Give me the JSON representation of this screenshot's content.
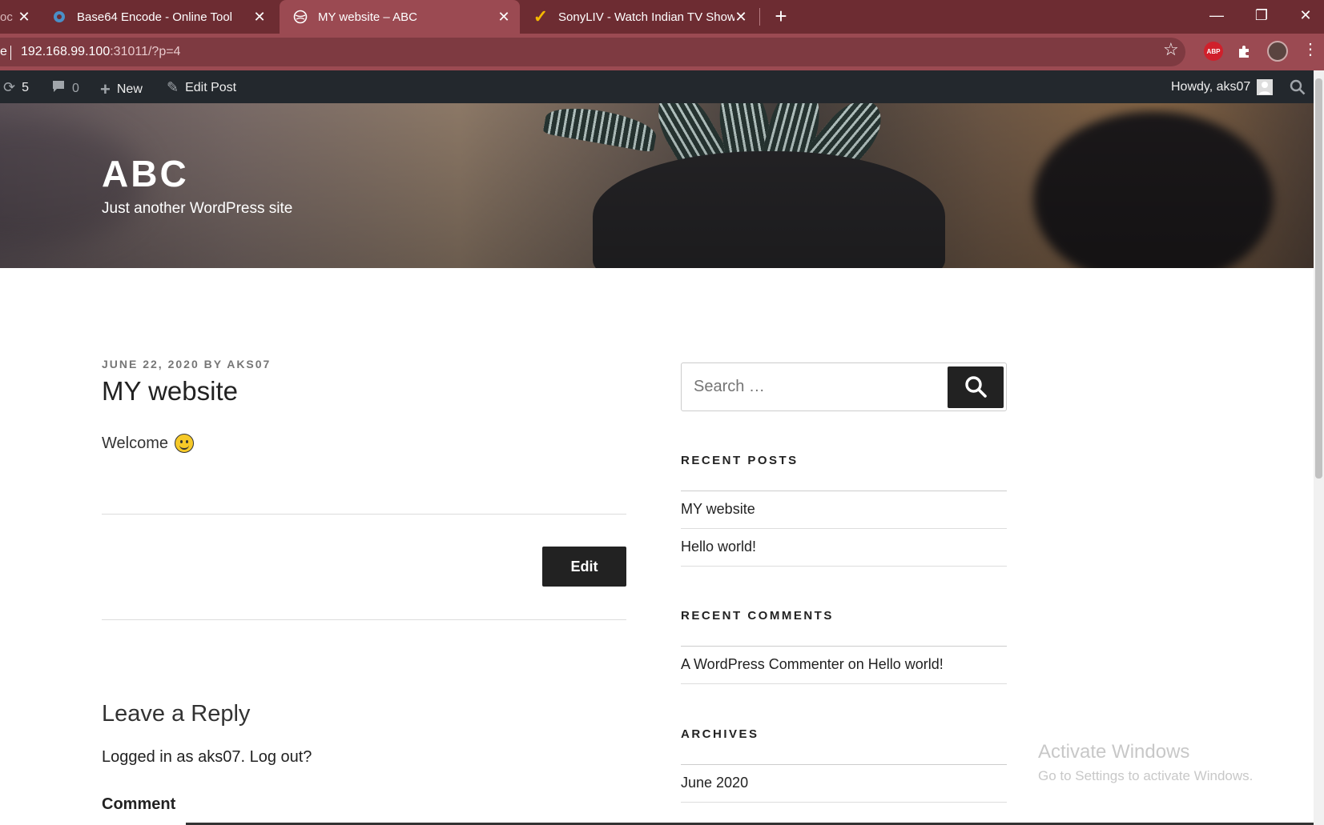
{
  "browser": {
    "tabs": [
      {
        "title": "oc",
        "icon": "doc-icon"
      },
      {
        "title": "Base64 Encode - Online Tool",
        "icon": "gear-icon"
      },
      {
        "title": "MY website – ABC",
        "icon": "globe-icon",
        "active": true
      },
      {
        "title": "SonyLIV - Watch Indian TV Show",
        "icon": "check-icon"
      }
    ],
    "url_host": "192.168.99.100",
    "url_rest": ":31011/?p=4",
    "omni_left": "e",
    "abp_label": "ABP"
  },
  "adminbar": {
    "updates_count": "5",
    "comments_count": "0",
    "new_label": "New",
    "edit_post_label": "Edit Post",
    "howdy": "Howdy, aks07"
  },
  "site": {
    "title": "ABC",
    "description": "Just another WordPress site"
  },
  "post": {
    "meta_date": "JUNE 22, 2020",
    "meta_by": " BY ",
    "meta_author": "AKS07",
    "title": "MY website",
    "body": "Welcome",
    "edit_label": "Edit"
  },
  "reply": {
    "title": "Leave a Reply",
    "logged_in": "Logged in as aks07. Log out?",
    "comment_label": "Comment"
  },
  "sidebar": {
    "search_placeholder": "Search …",
    "recent_posts_title": "RECENT POSTS",
    "recent_posts": [
      "MY website",
      "Hello world!"
    ],
    "recent_comments_title": "RECENT COMMENTS",
    "comment_author": "A WordPress Commenter",
    "comment_on": " on ",
    "comment_post": "Hello world!",
    "archives_title": "ARCHIVES",
    "archives": [
      "June 2020"
    ]
  },
  "watermark": {
    "line1": "Activate Windows",
    "line2": "Go to Settings to activate Windows."
  },
  "colors": {
    "chrome_frame": "#6d2c32",
    "chrome_active_tab": "#9b4a52",
    "admin_bar": "#23282d"
  }
}
